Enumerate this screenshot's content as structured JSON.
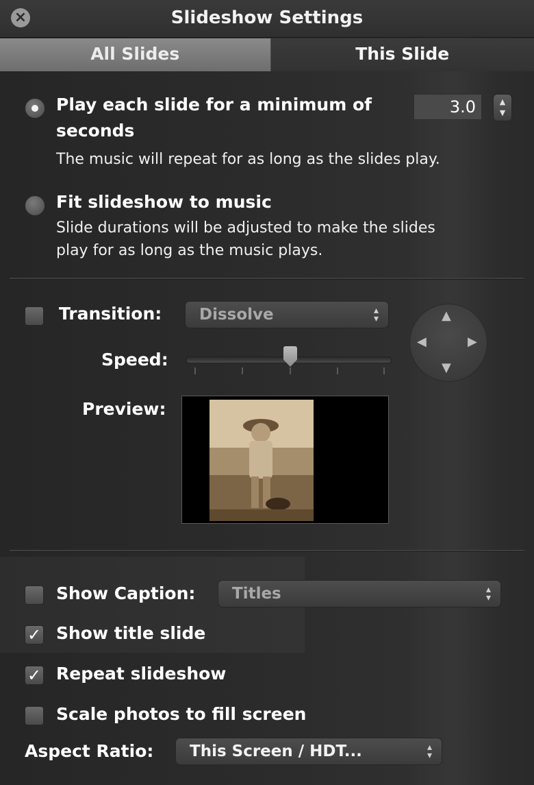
{
  "window": {
    "title": "Slideshow Settings"
  },
  "tabs": [
    {
      "label": "All Slides"
    },
    {
      "label": "This Slide"
    }
  ],
  "timing": {
    "option1_label": "Play each slide for a minimum of",
    "option1_value": "3.0",
    "option1_unit": "seconds",
    "option1_desc": "The music will repeat for as long as the slides play.",
    "option2_label": "Fit slideshow to music",
    "option2_desc_line1": "Slide durations will be adjusted to make the slides",
    "option2_desc_line2": "play for as long as the music plays.",
    "selected": "option1"
  },
  "transition": {
    "label": "Transition:",
    "value": "Dissolve",
    "checked": false,
    "speed_label": "Speed:",
    "speed_position": 0.5,
    "preview_label": "Preview:"
  },
  "options": {
    "show_caption_label": "Show Caption:",
    "show_caption_checked": false,
    "caption_value": "Titles",
    "show_title_slide_label": "Show title slide",
    "show_title_slide_checked": true,
    "repeat_label": "Repeat slideshow",
    "repeat_checked": true,
    "scale_label": "Scale photos to fill screen",
    "scale_checked": false,
    "aspect_label": "Aspect Ratio:",
    "aspect_value": "This Screen / HDT..."
  },
  "icons": {
    "close": "close-icon",
    "checkmark": "✓",
    "popup_arrows": "updown-arrows-icon"
  }
}
